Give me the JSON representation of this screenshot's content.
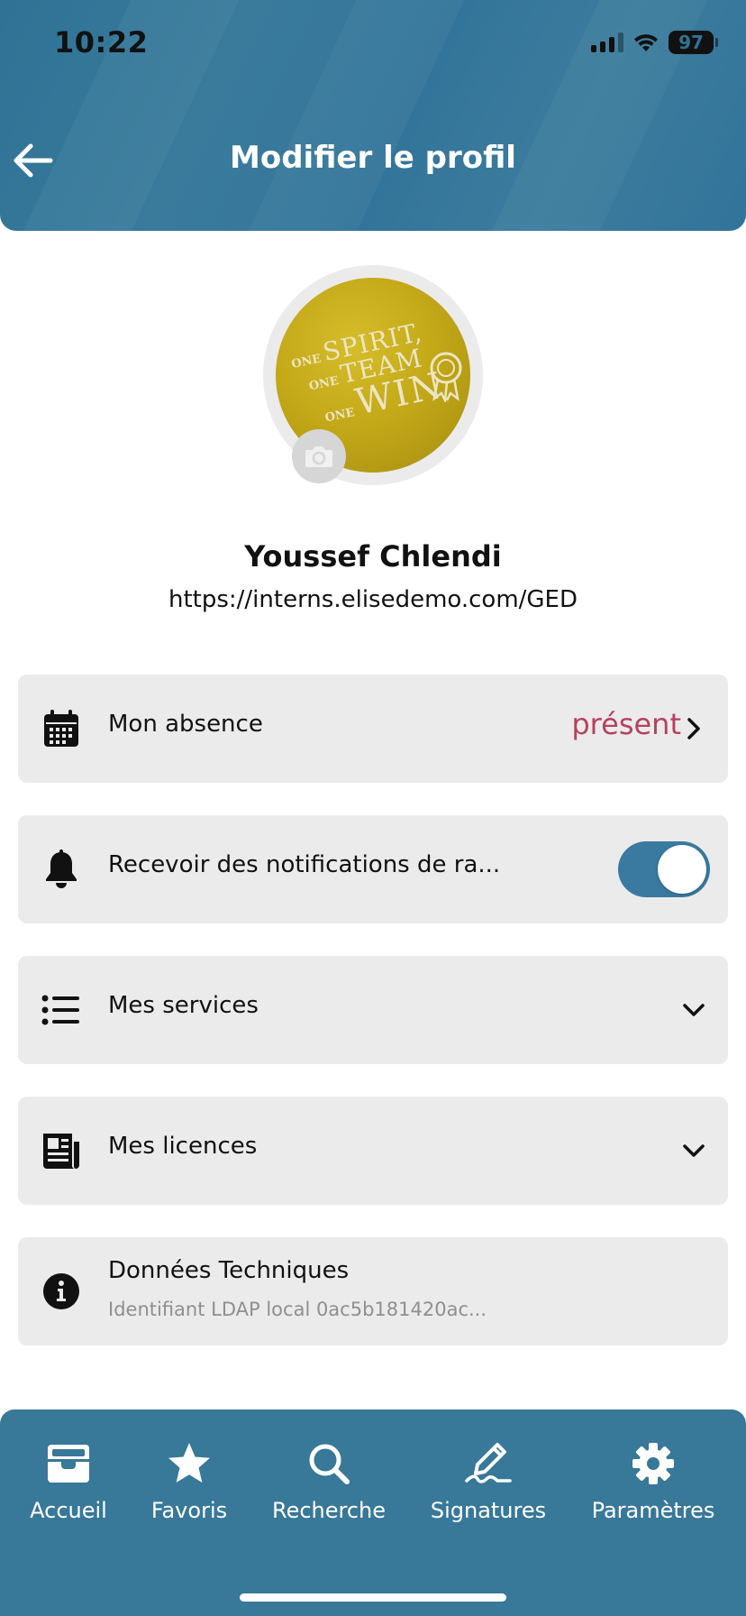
{
  "status_bar": {
    "time": "10:22",
    "battery": "97"
  },
  "header": {
    "title": "Modifier le profil"
  },
  "profile": {
    "name": "Youssef Chlendi",
    "url": "https://interns.elisedemo.com/GED",
    "avatar_text": {
      "line1_small": "ONE",
      "line1_big": "SPIRIT,",
      "line2_small": "ONE",
      "line2_big": "TEAM",
      "line3_small": "ONE",
      "line3_big": "WIN"
    }
  },
  "settings": {
    "absence": {
      "label": "Mon absence",
      "value": "présent"
    },
    "notifications": {
      "label": "Recevoir des notifications de ra...",
      "enabled": true
    },
    "services": {
      "label": "Mes services"
    },
    "licences": {
      "label": "Mes licences"
    },
    "tech": {
      "title": "Données Techniques",
      "subtitle": "Identifiant LDAP local 0ac5b181420ac..."
    }
  },
  "bottom_nav": [
    {
      "label": "Accueil",
      "icon": "inbox-icon"
    },
    {
      "label": "Favoris",
      "icon": "star-icon"
    },
    {
      "label": "Recherche",
      "icon": "search-icon"
    },
    {
      "label": "Signatures",
      "icon": "signature-icon"
    },
    {
      "label": "Paramètres",
      "icon": "gear-icon"
    }
  ],
  "colors": {
    "header": "#2f7295",
    "accent_status": "#b8405e",
    "toggle_on": "#3a7aa0",
    "card_bg": "#ebebeb"
  }
}
